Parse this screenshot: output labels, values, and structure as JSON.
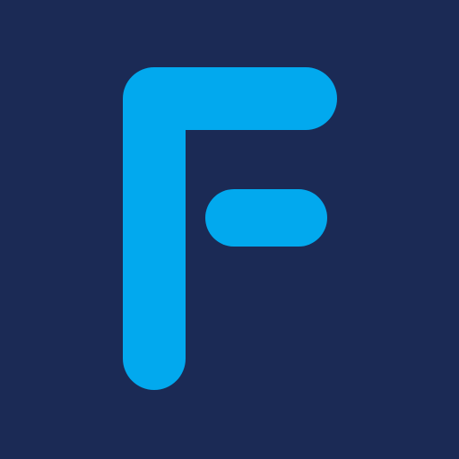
{
  "logo": {
    "name": "f-logo-icon",
    "background_color": "#1b2a55",
    "glyph_color": "#02a9ee"
  }
}
